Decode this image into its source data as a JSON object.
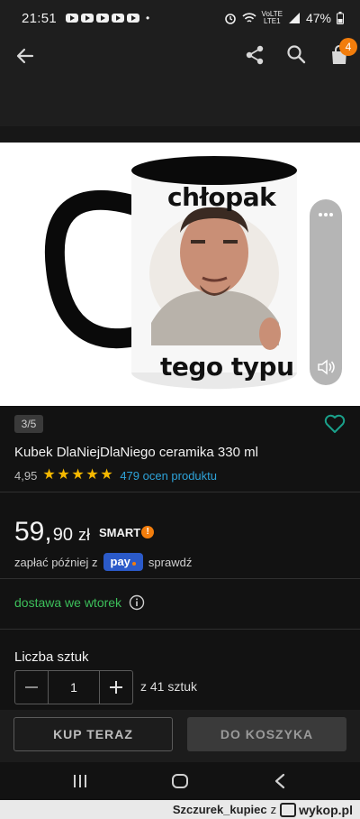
{
  "status_bar": {
    "time": "21:51",
    "battery": "47%",
    "network_top": "VoLTE",
    "network_bottom": "LTE1",
    "dot": "•"
  },
  "app_bar": {
    "cart_count": "4",
    "icons": [
      "back-arrow-icon",
      "share-icon",
      "search-icon",
      "shopping-bag-icon"
    ]
  },
  "product": {
    "image_counter": "3/5",
    "mug_text_top": "chłopak",
    "mug_text_bottom": "tego typu",
    "title": "Kubek DlaNiejDlaNiego ceramika 330 ml",
    "rating": "4,95",
    "stars": 5,
    "reviews": "479 ocen produktu",
    "price_main": "59,",
    "price_cents": "90",
    "price_currency": "zł",
    "smart_label": "SMART",
    "pay_later_prefix": "zapłać później z",
    "pay_logo": "pay",
    "pay_later_suffix": "sprawdź",
    "delivery": "dostawa we wtorek",
    "qty_label": "Liczba sztuk",
    "qty_value": "1",
    "stock": "z 41 sztuk"
  },
  "actions": {
    "buy_now": "KUP TERAZ",
    "add_to_cart": "DO KOSZYKA"
  },
  "watermark": {
    "user": "Szczurek_kupiec",
    "separator": "z",
    "site": "wykop.pl"
  },
  "colors": {
    "accent_orange": "#f27d0c",
    "star": "#f5b800",
    "link_blue": "#2ea3d9",
    "delivery_green": "#3cbf5a",
    "pay_blue": "#2b5ac9",
    "heart_teal": "#1aa08a"
  }
}
